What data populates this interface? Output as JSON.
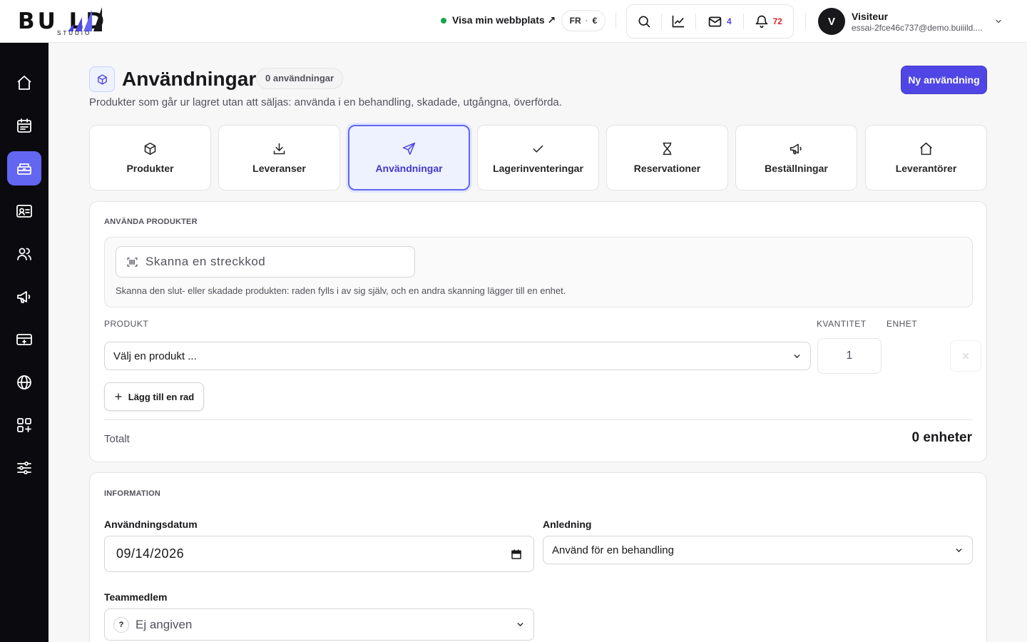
{
  "brand": {
    "logo_text": "BU  LD",
    "logo_sub": "STUDIO"
  },
  "topbar": {
    "site_link": "Visa min webbplats ↗",
    "lang": "FR",
    "currency": "€",
    "mail_count": "4",
    "notif_count": "72",
    "user_initial": "V",
    "user_name": "Visiteur",
    "user_email": "essai-2fce46c737@demo.buiiild...."
  },
  "sidebar": {
    "items": [
      "home-icon",
      "calendar-icon",
      "inventory-icon",
      "contact-card-icon",
      "users-icon",
      "megaphone-icon",
      "card-register-icon",
      "globe-icon",
      "apps-icon",
      "sliders-icon"
    ],
    "active_index": 2
  },
  "header": {
    "title": "Användningar",
    "count_badge": "0 användningar",
    "description": "Produkter som går ur lagret utan att säljas: använda i en behandling, skadade, utgångna, överförda.",
    "primary_button": "Ny användning"
  },
  "tabs": [
    {
      "label": "Produkter",
      "icon": "box-icon"
    },
    {
      "label": "Leveranser",
      "icon": "download-icon"
    },
    {
      "label": "Användningar",
      "icon": "send-icon",
      "active": true
    },
    {
      "label": "Lagerinventeringar",
      "icon": "check-icon"
    },
    {
      "label": "Reservationer",
      "icon": "hourglass-icon"
    },
    {
      "label": "Beställningar",
      "icon": "megaphone-icon"
    },
    {
      "label": "Leverantörer",
      "icon": "house-icon"
    }
  ],
  "products_section": {
    "title": "ANVÄNDA PRODUKTER",
    "scan_placeholder": "Skanna en streckkod",
    "scan_hint": "Skanna den slut- eller skadade produkten: raden fylls i av sig själv, och en andra skanning lägger till en enhet.",
    "col_product": "PRODUKT",
    "col_qty": "KVANTITET",
    "col_unit": "ENHET",
    "row": {
      "product_placeholder": "Välj en produkt ...",
      "quantity": "1",
      "unit": ""
    },
    "add_row": "Lägg till en rad",
    "total_label": "Totalt",
    "total_value": "0 enheter"
  },
  "info_section": {
    "title": "INFORMATION",
    "date_label": "Användningsdatum",
    "date_value": "09/14/2026",
    "reason_label": "Anledning",
    "reason_value": "Använd för en behandling",
    "member_label": "Teammedlem",
    "member_value": "Ej angiven",
    "member_mark": "?"
  },
  "colors": {
    "accent": "#4f46e5",
    "accent_light": "#6366f1",
    "sidebar_bg": "#0b0b0f",
    "online": "#16a34a",
    "notif": "#dc2626"
  }
}
